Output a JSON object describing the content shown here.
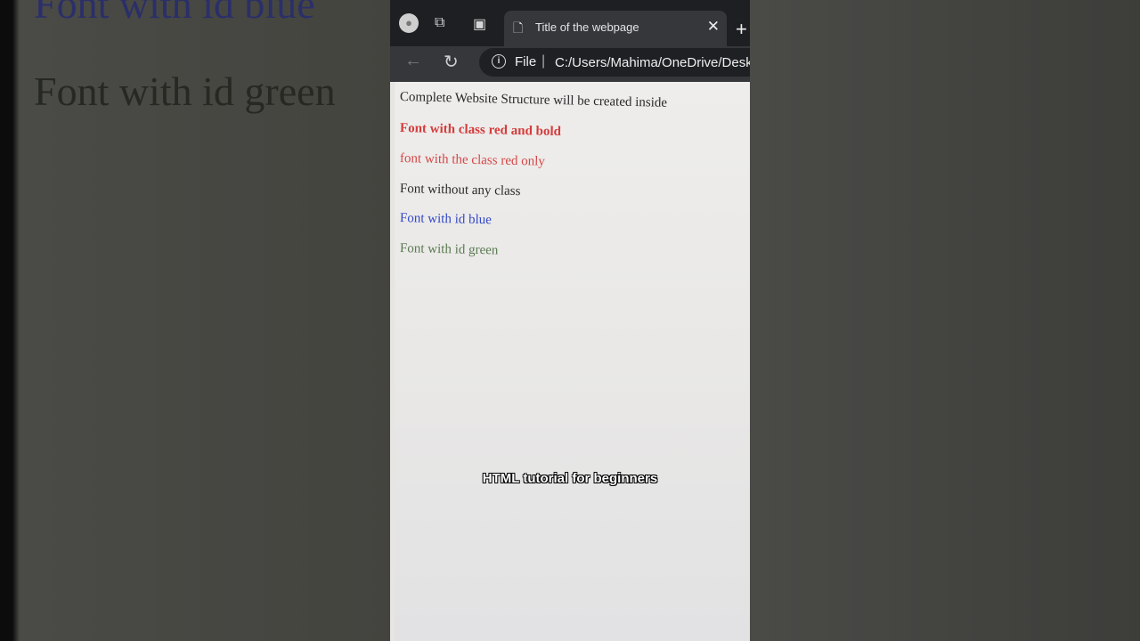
{
  "background": {
    "left_text_top": "Font with id blue",
    "left_text_bottom": "Font with id green"
  },
  "browser": {
    "tab_title": "Title of the webpage",
    "close_glyph": "✕",
    "new_tab_glyph": "+",
    "file_label": "File",
    "url": "C:/Users/Mahima/OneDrive/Deskto"
  },
  "page": {
    "lines": [
      {
        "text": "Complete Website Structure will be created inside",
        "color": "#2a2a2a"
      },
      {
        "text": "Font with class red and bold",
        "color": "#d43c3c"
      },
      {
        "text": "font with the class red only",
        "color": "#d44848"
      },
      {
        "text": "Font without any class",
        "color": "#2a2a2a"
      },
      {
        "text": "Font with id blue",
        "color": "#3348c8"
      },
      {
        "text": "Font with id green",
        "color": "#5b7a52"
      }
    ]
  },
  "caption": "HTML tutorial for beginners"
}
